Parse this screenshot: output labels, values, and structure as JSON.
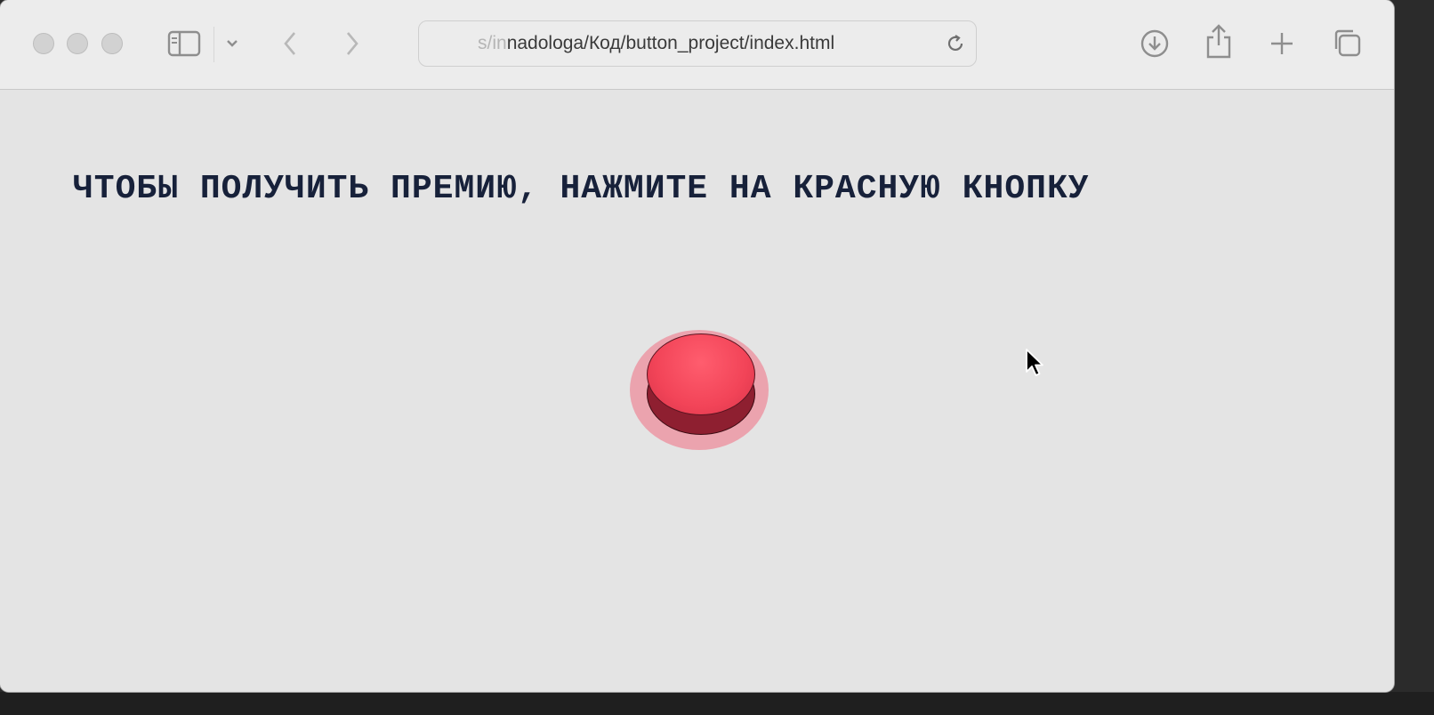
{
  "browser": {
    "url_faded": "s/in",
    "url_main": "nadologa/Код/button_project/index.html",
    "icons": {
      "sidebar": "sidebar-icon",
      "chevron": "chevron-down-icon",
      "back": "back-arrow-icon",
      "forward": "forward-arrow-icon",
      "reload": "reload-icon",
      "download": "download-icon",
      "share": "share-icon",
      "new_tab": "plus-icon",
      "tabs": "tabs-overview-icon"
    }
  },
  "page": {
    "headline": "ЧТОБЫ ПОЛУЧИТЬ ПРЕМИЮ, НАЖМИТЕ НА КРАСНУЮ КНОПКУ",
    "button_color": "#f24458"
  }
}
